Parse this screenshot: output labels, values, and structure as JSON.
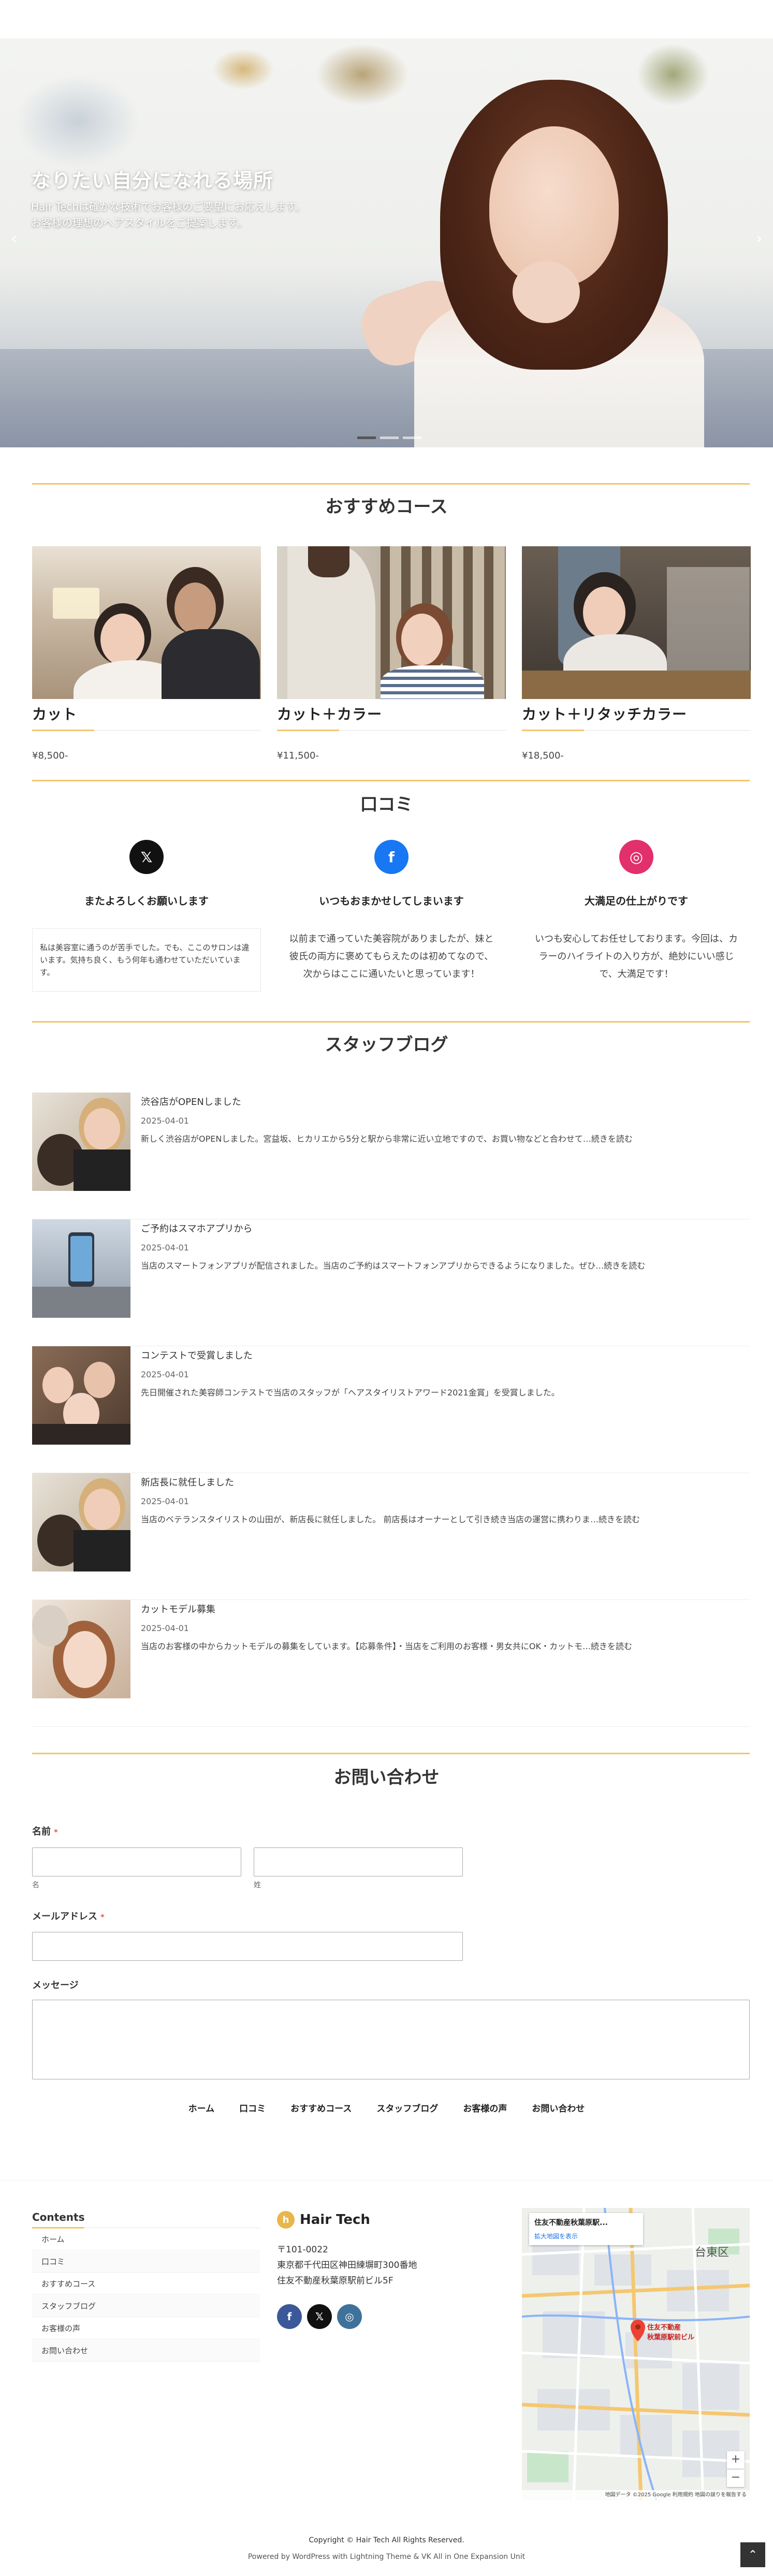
{
  "hero": {
    "title": "なりたい自分になれる場所",
    "line1": "Hair Techは確かな技術でお客様のご要望にお応えします。",
    "line2": "お客様の理想のヘアスタイルをご提案します。",
    "prev_icon": "chevron-left-icon",
    "next_icon": "chevron-right-icon",
    "slides_count": 3,
    "active_slide": 1
  },
  "courses": {
    "title": "おすすめコース",
    "items": [
      {
        "name": "カット",
        "price": "¥8,500-"
      },
      {
        "name": "カット＋カラー",
        "price": "¥11,500-"
      },
      {
        "name": "カット＋リタッチカラー",
        "price": "¥18,500-"
      }
    ]
  },
  "reviews": {
    "title": "口コミ",
    "items": [
      {
        "icon": "x-icon",
        "title": "またよろしくお願いします",
        "text": "私は美容室に通うのが苦手でした。でも、ここのサロンは違います。気持ち良く、もう何年も通わせていただいています。"
      },
      {
        "icon": "facebook-icon",
        "title": "いつもおまかせしてしまいます",
        "text1": "以前まで通っていた美容院がありましたが、妹と",
        "text2": "彼氏の両方に褒めてもらえたのは初めてなので、",
        "text3": "次からはここに通いたいと思っています！"
      },
      {
        "icon": "instagram-icon",
        "title": "大満足の仕上がりです",
        "text1": "いつも安心してお任せしております。今回は、カ",
        "text2": "ラーのハイライトの入り方が、絶妙にいい感じ",
        "text3": "で、大満足です！"
      }
    ]
  },
  "blog": {
    "title": "スタッフブログ",
    "posts": [
      {
        "title": "渋谷店がOPENしました",
        "date": "2025-04-01",
        "excerpt": "新しく渋谷店がOPENしました。宮益坂、ヒカリエから5分と駅から非常に近い立地ですので、お買い物などと合わせて…続きを読む"
      },
      {
        "title": "ご予約はスマホアプリから",
        "date": "2025-04-01",
        "excerpt": "当店のスマートフォンアプリが配信されました。当店のご予約はスマートフォンアプリからできるようになりました。ぜひ…続きを読む"
      },
      {
        "title": "コンテストで受賞しました",
        "date": "2025-04-01",
        "excerpt": "先日開催された美容師コンテストで当店のスタッフが「ヘアスタイリストアワード2021金賞」を受賞しました。"
      },
      {
        "title": "新店長に就任しました",
        "date": "2025-04-01",
        "excerpt": "当店のベテランスタイリストの山田が、新店長に就任しました。 前店長はオーナーとして引き続き当店の運営に携わりま…続きを読む"
      },
      {
        "title": "カットモデル募集",
        "date": "2025-04-01",
        "excerpt": "当店のお客様の中からカットモデルの募集をしています。【応募条件】・当店をご利用のお客様・男女共にOK・カットモ…続きを読む"
      }
    ]
  },
  "contact": {
    "title": "お問い合わせ",
    "name_label": "名前",
    "required_mark": "*",
    "first_hint": "名",
    "last_hint": "姓",
    "email_label": "メールアドレス",
    "message_label": "メッセージ"
  },
  "footer_nav": [
    "ホーム",
    "口コミ",
    "おすすめコース",
    "スタッフブログ",
    "お客様の声",
    "お問い合わせ"
  ],
  "footer": {
    "contents_title": "Contents",
    "menu": [
      "ホーム",
      "口コミ",
      "おすすめコース",
      "スタッフブログ",
      "お客様の声",
      "お問い合わせ"
    ],
    "logo_mark": "h",
    "logo_text": "Hair Tech",
    "zip": "〒101-0022",
    "address1": "東京都千代田区神田練塀町300番地",
    "address2": "住友不動産秋葉原駅前ビル5F",
    "social": [
      "facebook-icon",
      "x-icon",
      "instagram-icon"
    ],
    "map_place": "住友不動産秋葉原駅...",
    "map_link": "拡大地図を表示",
    "map_pin": "住友不動産\n秋葉原駅前ビル",
    "map_ward": "台東区",
    "map_credit": "地図データ ©2025 Google 利用規約 地図の誤りを報告する",
    "copyright": "Copyright © Hair Tech All Rights Reserved.",
    "powered": "Powered by WordPress with Lightning Theme & VK All in One Expansion Unit"
  },
  "colors": {
    "accent": "#f3c571",
    "x": "#111111",
    "facebook": "#1877f2",
    "instagram": "#e1306c"
  }
}
